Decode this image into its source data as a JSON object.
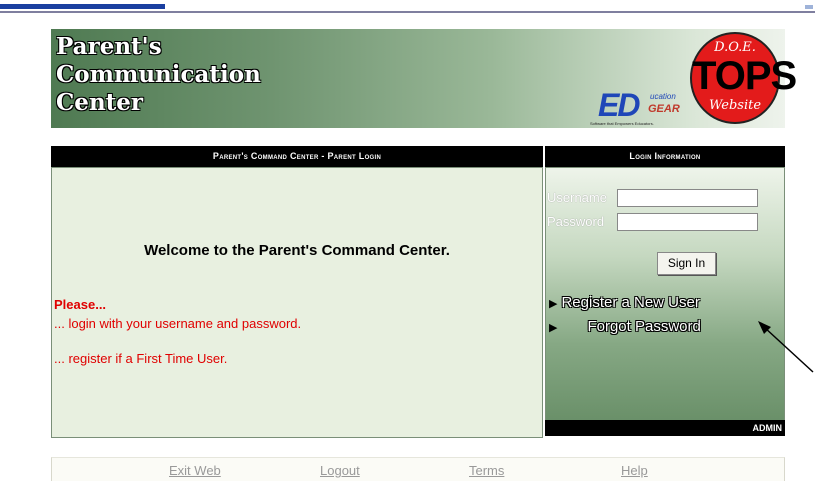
{
  "banner": {
    "title_lines": [
      "Parent's",
      "Communication",
      "Center"
    ],
    "edgear_logo": {
      "ed": "ED",
      "ucation": "ucation",
      "gear": "GEAR",
      "tagline": "Software that Empowers Educators."
    },
    "tops_logo": {
      "top": "D.O.E.",
      "main": "TOPS",
      "bottom": "Website",
      "color": "#e31b1b"
    }
  },
  "left_panel": {
    "header": "Parent's Command Center - Parent Login",
    "welcome": "Welcome to the Parent's Command Center.",
    "please": "Please...",
    "line1": "... login with your username and password.",
    "line2": "... register if a First Time User."
  },
  "right_panel": {
    "header": "Login Information",
    "username_label": "Username",
    "username_value": "",
    "password_label": "Password",
    "password_value": "",
    "signin_label": "Sign In",
    "register_link": "Register a New User",
    "forgot_link": "Forgot Password",
    "admin_label": "ADMIN"
  },
  "footer": {
    "exit": "Exit Web",
    "logout": "Logout",
    "terms": "Terms",
    "help": "Help"
  },
  "icons": {
    "link_marker": "triangle-right-icon",
    "annotation": "arrow-icon"
  }
}
